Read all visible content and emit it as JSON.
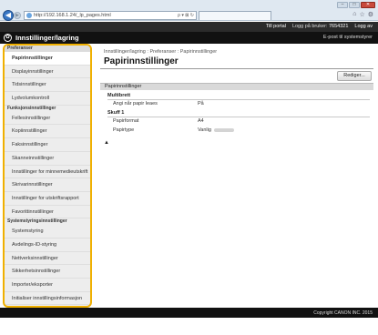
{
  "browser": {
    "address": "http://192.168.1.24/_lp_pages.html",
    "address_controls": "ρ ▾ ⊠ ↻",
    "window_controls": [
      "–",
      "□",
      "✕"
    ],
    "toolbar_icons": [
      "⌂",
      "☆",
      "⚙"
    ]
  },
  "header": {
    "title": "Innstillinger/lagring",
    "top_links": {
      "portal": "Till portal",
      "login_label": "Logg på bruker:",
      "user_id": "7654321",
      "logout": "Logg av"
    },
    "email_admin": "E-post til systemstyrer"
  },
  "sidebar": {
    "sections": [
      {
        "heading": "Preferanser",
        "items": [
          "Papirinnstillinger",
          "Displayinnstillinger",
          "Tidsinnstillinger",
          "Lydvolumkontroll"
        ]
      },
      {
        "heading": "Funksjonsinnstillinger",
        "items": [
          "Fellesinnstillinger",
          "Kopiinnstillinger",
          "Faksinnstillinger",
          "Skanneinnstillinger",
          "Innstillinger for minnemedieutskrift",
          "Skrivarinnstillinger",
          "Innstillinger for utskriftsrapport",
          "Favorittinnstillinger"
        ]
      },
      {
        "heading": "Systemstyringsinnstillinger",
        "items": [
          "Systemstyring",
          "Avdelings-ID-styring",
          "Nettverksinnstillinger",
          "Sikkerhetsinnstillinger",
          "Importer/eksporter",
          "Initialiser innstillingsinformasjon"
        ]
      }
    ],
    "active": "Papirinnstillinger"
  },
  "main": {
    "breadcrumb": "Innstillinger/lagring : Preferanser : Papirinnstillinger",
    "title": "Papirinnstillinger",
    "edit_label": "Rediger...",
    "panel_title": "Papirinnstillinger",
    "groups": [
      {
        "title": "Multibrett",
        "rows": [
          {
            "label": "Angi når papir leaes",
            "value": "På"
          }
        ]
      },
      {
        "title": "Skuff 1",
        "rows": [
          {
            "label": "Papirformat",
            "value": "A4"
          },
          {
            "label": "Papirtype",
            "value": "Vanlig"
          }
        ]
      }
    ],
    "back_to_top": "▲"
  },
  "footer": {
    "copyright": "Copyright CANON INC. 2015"
  }
}
